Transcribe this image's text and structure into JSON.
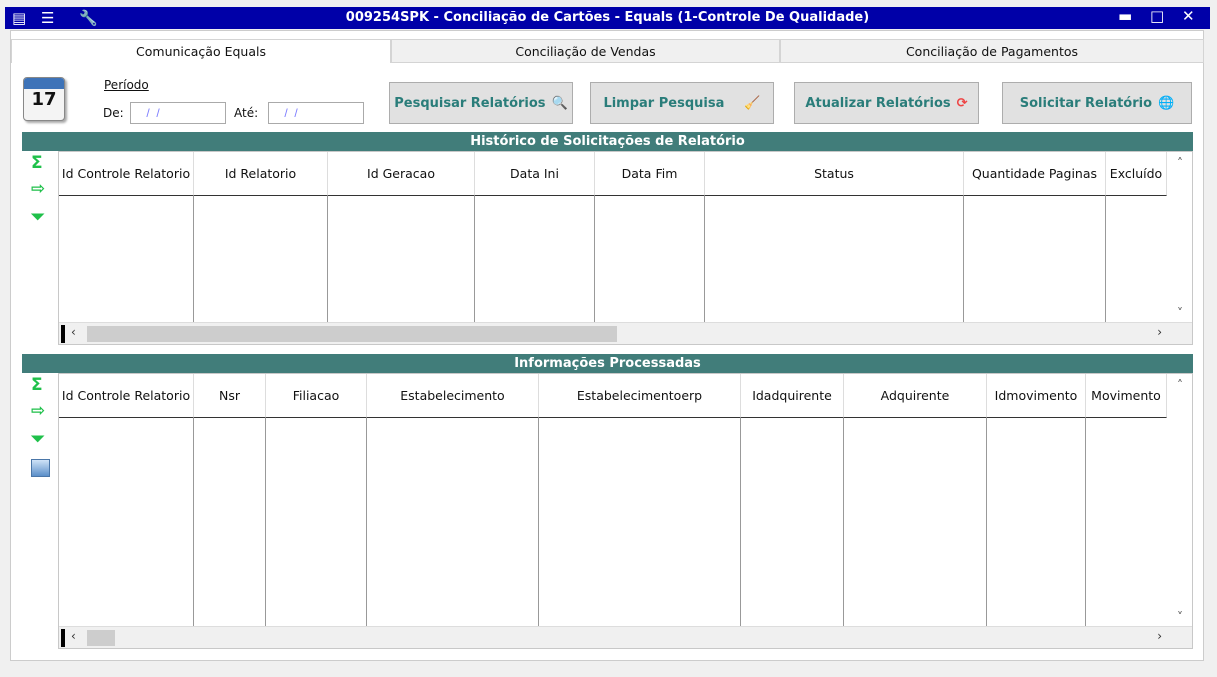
{
  "window": {
    "title": "009254SPK - Conciliação de Cartões - Equals (1-Controle De Qualidade)",
    "icons": [
      "report-icon",
      "traffic-light-icon",
      "wrench-icon"
    ],
    "controls": [
      "minimize",
      "maximize",
      "close"
    ]
  },
  "tabs": [
    {
      "label": "Comunicação Equals",
      "active": true
    },
    {
      "label": "Conciliação de Vendas",
      "active": false
    },
    {
      "label": "Conciliação de Pagamentos",
      "active": false
    }
  ],
  "period": {
    "label": "Período",
    "from_label": "De:",
    "from_value": " /  /",
    "to_label": "Até:",
    "to_value": " /  /",
    "calendar_day": "17"
  },
  "buttons": {
    "search": "Pesquisar Relatórios",
    "clear": "Limpar Pesquisa",
    "refresh": "Atualizar Relatórios",
    "request": "Solicitar Relatório"
  },
  "history": {
    "title": "Histórico de Solicitações de Relatório",
    "columns": [
      "Id Controle Relatorio",
      "Id Relatorio",
      "Id Geracao",
      "Data Ini",
      "Data Fim",
      "Status",
      "Quantidade Paginas",
      "Excluído"
    ],
    "rows": []
  },
  "processed": {
    "title": "Informações Processadas",
    "columns": [
      "Id Controle Relatorio",
      "Nsr",
      "Filiacao",
      "Estabelecimento",
      "Estabelecimentoerp",
      "Idadquirente",
      "Adquirente",
      "Idmovimento",
      "Movimento"
    ],
    "rows": []
  },
  "colors": {
    "titlebar": "#0000a8",
    "section_bar": "#417d7a",
    "button_text": "#2a7d7a",
    "side_icons": "#1fc04a"
  }
}
